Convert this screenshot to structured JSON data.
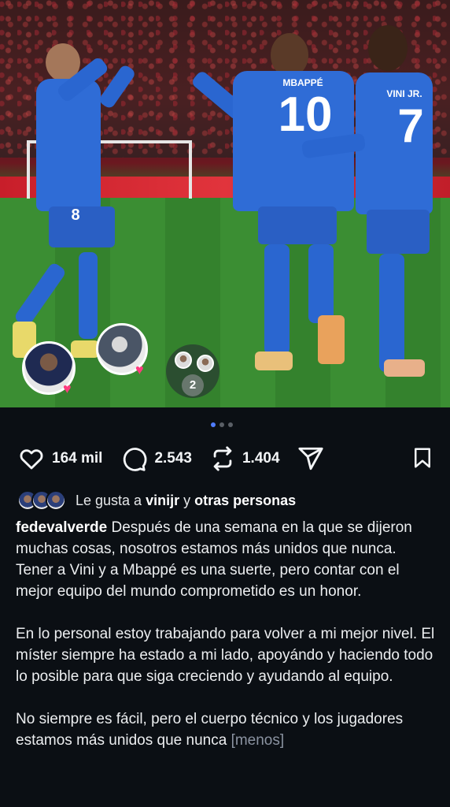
{
  "post": {
    "carousel": {
      "count": 3,
      "active_index": 0
    },
    "stickers": {
      "group_count": "2"
    }
  },
  "actions": {
    "like_count": "164 mil",
    "comment_count": "2.543",
    "repost_count": "1.404"
  },
  "likes": {
    "prefix": "Le gusta a",
    "user": "vinijr",
    "connector": "y",
    "others": "otras personas"
  },
  "caption": {
    "username": "fedevalverde",
    "para1": "Después de una semana en la que se dijeron muchas cosas, nosotros estamos más unidos que nunca.",
    "para2": "Tener a Vini y a Mbappé es una suerte, pero contar con el mejor equipo del mundo comprometido es un honor.",
    "para3": "En lo personal estoy trabajando para volver a mi mejor nivel. El míster siempre ha estado a mi lado, apoyándo y haciendo todo lo posible para que siga creciendo y ayudando al equipo.",
    "para4": "No siempre es fácil, pero el cuerpo técnico y los jugadores estamos más unidos que nunca",
    "less_link": "[menos]"
  },
  "photo_text": {
    "player_2_name": "MBAPPÉ",
    "player_2_number": "10",
    "player_3_name": "VINI JR.",
    "player_3_number": "7",
    "player_1_number": "8"
  },
  "colors": {
    "background": "#0b0f14",
    "accent_dot": "#4f7cff",
    "heart_badge": "#ff3d7f"
  },
  "icons": [
    "heart-icon",
    "comment-icon",
    "repost-icon",
    "share-icon",
    "bookmark-icon"
  ]
}
